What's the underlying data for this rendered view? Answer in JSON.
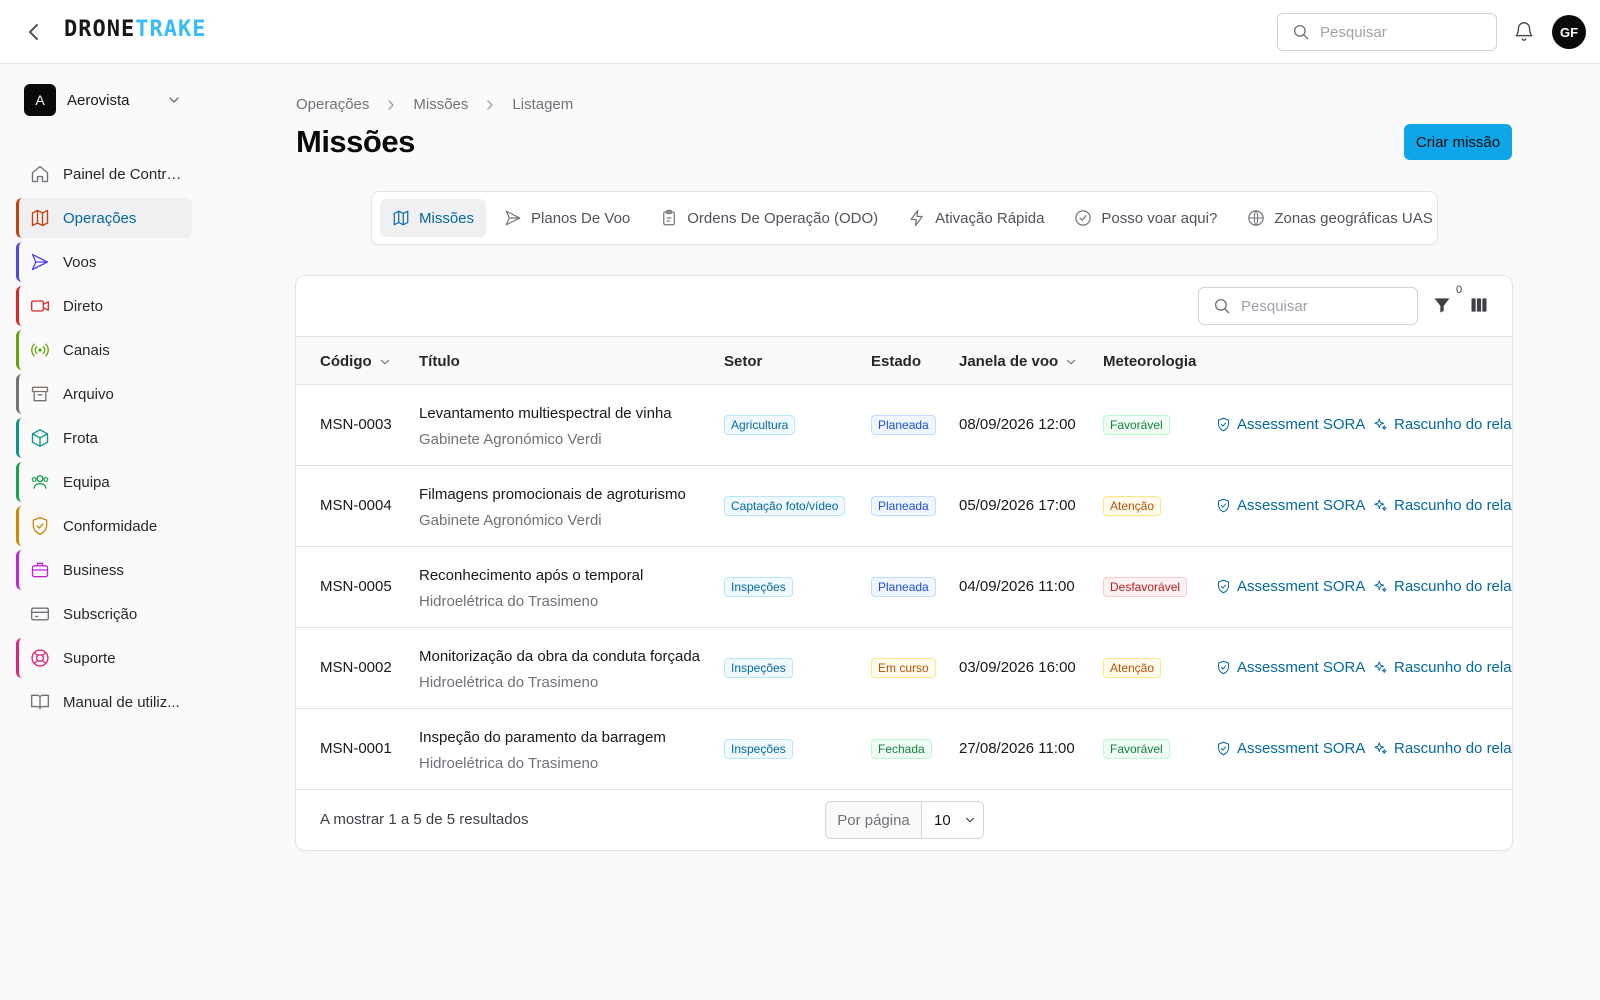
{
  "header": {
    "logo_part1": "DRONE",
    "logo_part2": "TRAKE",
    "search_placeholder": "Pesquisar",
    "avatar_initials": "GF"
  },
  "org": {
    "initial": "A",
    "name": "Aerovista"
  },
  "sidebar": {
    "items": [
      {
        "label": "Painel de Controlo",
        "icon": "home-icon",
        "color": "#71717a",
        "active": false
      },
      {
        "label": "Operações",
        "icon": "map-icon",
        "color": "#c2410c",
        "active": true
      },
      {
        "label": "Voos",
        "icon": "send-icon",
        "color": "#4f46e5",
        "active": false
      },
      {
        "label": "Direto",
        "icon": "video-icon",
        "color": "#dc2626",
        "active": false
      },
      {
        "label": "Canais",
        "icon": "radio-icon",
        "color": "#65a30d",
        "active": false
      },
      {
        "label": "Arquivo",
        "icon": "archive-icon",
        "color": "#78716c",
        "active": false
      },
      {
        "label": "Frota",
        "icon": "box-icon",
        "color": "#0d9488",
        "active": false
      },
      {
        "label": "Equipa",
        "icon": "users-icon",
        "color": "#16a34a",
        "active": false
      },
      {
        "label": "Conformidade",
        "icon": "shield-check-icon",
        "color": "#ca8a04",
        "active": false
      },
      {
        "label": "Business",
        "icon": "briefcase-icon",
        "color": "#c026d3",
        "active": false
      },
      {
        "label": "Subscrição",
        "icon": "credit-card-icon",
        "color": "#71717a",
        "active": false
      },
      {
        "label": "Suporte",
        "icon": "life-buoy-icon",
        "color": "#db2777",
        "active": false
      },
      {
        "label": "Manual de utiliz...",
        "icon": "book-icon",
        "color": "#71717a",
        "active": false
      }
    ]
  },
  "breadcrumb": [
    "Operações",
    "Missões",
    "Listagem"
  ],
  "page": {
    "title": "Missões",
    "create_label": "Criar missão"
  },
  "tabs": [
    {
      "label": "Missões",
      "icon": "map-icon",
      "active": true
    },
    {
      "label": "Planos De Voo",
      "icon": "send-icon",
      "active": false
    },
    {
      "label": "Ordens De Operação (ODO)",
      "icon": "clipboard-icon",
      "active": false
    },
    {
      "label": "Ativação Rápida",
      "icon": "zap-icon",
      "active": false
    },
    {
      "label": "Posso voar aqui?",
      "icon": "check-circle-icon",
      "active": false
    },
    {
      "label": "Zonas geográficas UAS",
      "icon": "globe-icon",
      "active": false
    }
  ],
  "table": {
    "search_placeholder": "Pesquisar",
    "filter_count": "0",
    "columns": [
      "Código",
      "Título",
      "Setor",
      "Estado",
      "Janela de voo",
      "Meteorologia"
    ],
    "action_sora": "Assessment SORA",
    "action_draft": "Rascunho do relat",
    "rows": [
      {
        "code": "MSN-0003",
        "title": "Levantamento multiespectral de vinha",
        "client": "Gabinete Agronómico Verdi",
        "setor": "Agricultura",
        "setor_tone": "b-sky",
        "estado": "Planeada",
        "estado_tone": "b-blue",
        "janela": "08/09/2026 12:00",
        "meteo": "Favorável",
        "meteo_tone": "b-green"
      },
      {
        "code": "MSN-0004",
        "title": "Filmagens promocionais de agroturismo",
        "client": "Gabinete Agronómico Verdi",
        "setor": "Captação foto/vídeo",
        "setor_tone": "b-sky",
        "estado": "Planeada",
        "estado_tone": "b-blue",
        "janela": "05/09/2026 17:00",
        "meteo": "Atenção",
        "meteo_tone": "b-amber"
      },
      {
        "code": "MSN-0005",
        "title": "Reconhecimento após o temporal",
        "client": "Hidroelétrica do Trasimeno",
        "setor": "Inspeções",
        "setor_tone": "b-sky",
        "estado": "Planeada",
        "estado_tone": "b-blue",
        "janela": "04/09/2026 11:00",
        "meteo": "Desfavorável",
        "meteo_tone": "b-red"
      },
      {
        "code": "MSN-0002",
        "title": "Monitorização da obra da conduta forçada",
        "client": "Hidroelétrica do Trasimeno",
        "setor": "Inspeções",
        "setor_tone": "b-sky",
        "estado": "Em curso",
        "estado_tone": "b-amber",
        "janela": "03/09/2026 16:00",
        "meteo": "Atenção",
        "meteo_tone": "b-amber"
      },
      {
        "code": "MSN-0001",
        "title": "Inspeção do paramento da barragem",
        "client": "Hidroelétrica do Trasimeno",
        "setor": "Inspeções",
        "setor_tone": "b-sky",
        "estado": "Fechada",
        "estado_tone": "b-green",
        "janela": "27/08/2026 11:00",
        "meteo": "Favorável",
        "meteo_tone": "b-green"
      }
    ]
  },
  "footer": {
    "results_text": "A mostrar 1 a 5 de 5 resultados",
    "per_page_label": "Por página",
    "per_page_value": "10"
  }
}
